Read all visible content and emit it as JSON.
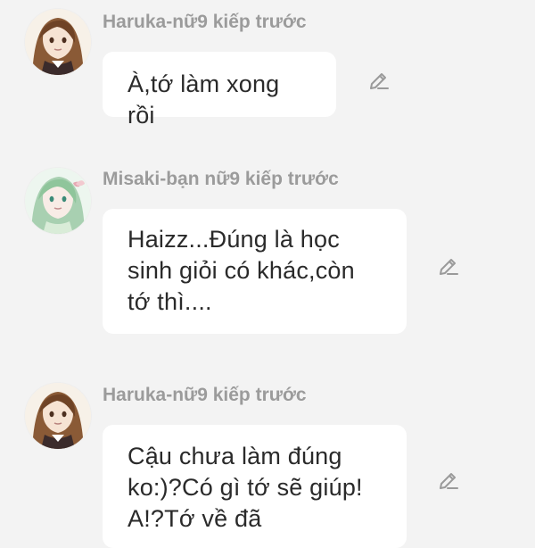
{
  "messages": [
    {
      "sender": "Haruka-nữ9 kiếp trước",
      "lines": [
        "À,tớ làm xong rồi"
      ],
      "avatar_icon": "girl-brown-hair-avatar-icon",
      "edit_icon": "pencil-edit-icon"
    },
    {
      "sender": "Misaki-bạn nữ9 kiếp trước",
      "lines": [
        "Haizz...Đúng là học",
        "sinh giỏi có khác,còn",
        "tớ thì...."
      ],
      "avatar_icon": "girl-green-hair-avatar-icon",
      "edit_icon": "pencil-edit-icon"
    },
    {
      "sender": "Haruka-nữ9 kiếp trước",
      "lines": [
        "Cậu chưa làm đúng",
        "ko:)?Có gì tớ sẽ giúp!",
        "A!?Tớ về đã"
      ],
      "avatar_icon": "girl-brown-hair-avatar-icon",
      "edit_icon": "pencil-edit-icon"
    }
  ],
  "colors": {
    "background": "#f3f3f3",
    "bubble": "#ffffff",
    "sender_text": "#9b9b9b",
    "message_text": "#2a2a2a",
    "icon_gray": "#9a9a9a"
  }
}
